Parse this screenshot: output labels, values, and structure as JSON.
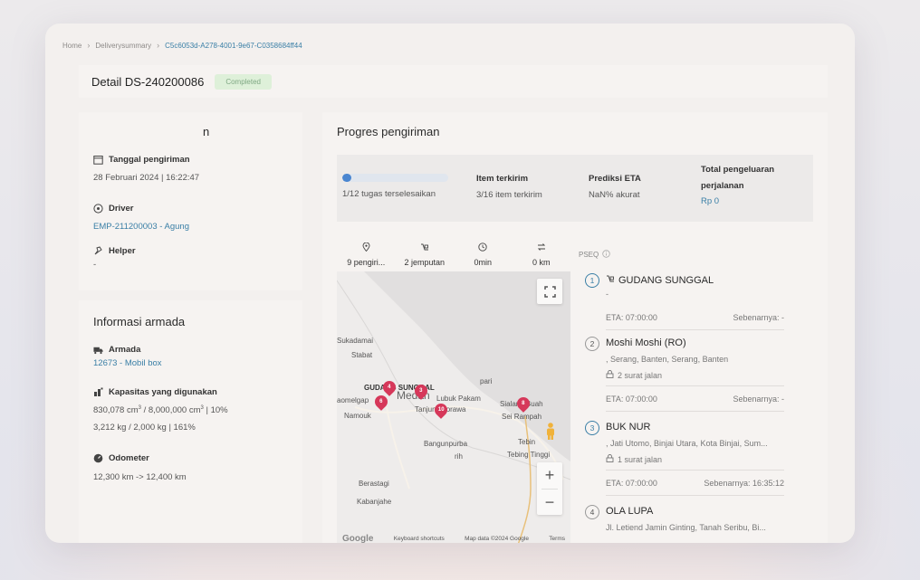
{
  "breadcrumb": {
    "items": [
      "Home",
      "Deliverysummary"
    ],
    "current": "C5c6053d-A278-4001-9e67-C0358684ff44"
  },
  "header": {
    "title": "Detail DS-240200086",
    "status": "Completed"
  },
  "info": {
    "title_fragment": "n",
    "tanggal_label": "Tanggal pengiriman",
    "tanggal_value": "28 Februari 2024 | 16:22:47",
    "driver_label": "Driver",
    "driver_value": "EMP-211200003 - Agung",
    "helper_label": "Helper",
    "helper_value": "-"
  },
  "armada": {
    "title": "Informasi armada",
    "armada_label": "Armada",
    "armada_value": "12673 - Mobil box",
    "kapasitas_label": "Kapasitas yang digunakan",
    "kapasitas_volume_prefix": "830,078 cm",
    "kapasitas_volume_mid": " / 8,000,000 cm",
    "kapasitas_volume_pct": " | 10%",
    "kapasitas_weight": "3,212 kg / 2,000 kg | 161%",
    "odometer_label": "Odometer",
    "odometer_value": "12,300 km -> 12,400 km"
  },
  "progress": {
    "title": "Progres pengiriman",
    "tasks_text": "1/12 tugas terselesaikan",
    "tasks_fraction": 0.083,
    "item_label": "Item terkirim",
    "item_value": "3/16 item terkirim",
    "eta_label": "Prediksi ETA",
    "eta_value": "NaN% akurat",
    "cost_label_1": "Total pengeluaran",
    "cost_label_2": "perjalanan",
    "cost_value": "Rp 0"
  },
  "map_tabs": [
    {
      "icon": "location-icon",
      "label": "9 pengiri..."
    },
    {
      "icon": "truck-icon",
      "label": "2 jemputan"
    },
    {
      "icon": "clock-icon",
      "label": "0min"
    },
    {
      "icon": "route-icon",
      "label": "0 km"
    }
  ],
  "map": {
    "labels": {
      "sukadamai": "Sukadamai",
      "stabat": "Stabat",
      "gudang": "GUDANG SUNGGAL",
      "medan": "Medan",
      "pari": "pari",
      "lubuk": "Lubuk Pakam",
      "tanjung": "Tanjungmorawa",
      "sialang": "Sialang Buah",
      "sei": "Sei Rampah",
      "bangun": "Bangunpurba",
      "rih": "rih",
      "tebing1": "Tebin",
      "tebing2": "Tebing Tinggi",
      "berastagi": "Berastagi",
      "kabanjahe": "Kabanjahe",
      "aomelgap": "aomelgap",
      "namouk": "Namouk"
    },
    "pins": [
      "4",
      "6",
      "3",
      "10",
      "8"
    ],
    "footer_google": "Google",
    "footer_shortcuts": "Keyboard shortcuts",
    "footer_data": "Map data ©2024 Google",
    "footer_terms": "Terms"
  },
  "pseq": {
    "header": "PSEQ",
    "stops": [
      {
        "num": "1",
        "name": "GUDANG SUNGGAL",
        "addr": "-",
        "sj": "",
        "eta": "ETA: 07:00:00",
        "actual": "Sebenarnya: -"
      },
      {
        "num": "2",
        "name": "Moshi Moshi (RO)",
        "addr": ", Serang, Banten, Serang, Banten",
        "sj": "2 surat jalan",
        "eta": "ETA: 07:00:00",
        "actual": "Sebenarnya: -"
      },
      {
        "num": "3",
        "name": "BUK NUR",
        "addr": ", Jati Utomo, Binjai Utara, Kota Binjai, Sum...",
        "sj": "1 surat jalan",
        "eta": "ETA: 07:00:00",
        "actual": "Sebenarnya: 16:35:12"
      },
      {
        "num": "4",
        "name": "OLA LUPA",
        "addr": "Jl. Letiend Jamin Ginting, Tanah Seribu, Bi...",
        "sj": "",
        "eta": "",
        "actual": ""
      }
    ]
  }
}
